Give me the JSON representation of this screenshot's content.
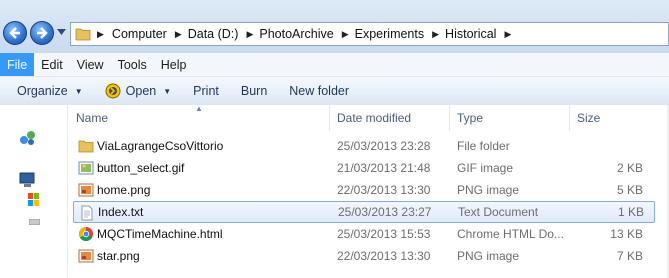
{
  "address_bar": {
    "crumbs": [
      "Computer",
      "Data (D:)",
      "PhotoArchive",
      "Experiments",
      "Historical"
    ]
  },
  "menu": [
    "File",
    "Edit",
    "View",
    "Tools",
    "Help"
  ],
  "command_bar": {
    "organize": "Organize",
    "open": "Open",
    "print": "Print",
    "burn": "Burn",
    "new_folder": "New folder"
  },
  "columns": {
    "name": "Name",
    "date_modified": "Date modified",
    "type": "Type",
    "size": "Size"
  },
  "files": [
    {
      "name": "ViaLagrangeCsoVittorio",
      "date": "25/03/2013 23:28",
      "type": "File folder",
      "size": "",
      "icon": "folder-icon"
    },
    {
      "name": "button_select.gif",
      "date": "21/03/2013 21:48",
      "type": "GIF image",
      "size": "2 KB",
      "icon": "image-file-icon"
    },
    {
      "name": "home.png",
      "date": "22/03/2013 13:30",
      "type": "PNG image",
      "size": "5 KB",
      "icon": "image-file-icon"
    },
    {
      "name": "Index.txt",
      "date": "25/03/2013 23:27",
      "type": "Text Document",
      "size": "1 KB",
      "icon": "text-file-icon"
    },
    {
      "name": "MQCTimeMachine.html",
      "date": "25/03/2013 15:53",
      "type": "Chrome HTML Do...",
      "size": "13 KB",
      "icon": "chrome-icon"
    },
    {
      "name": "star.png",
      "date": "22/03/2013 13:30",
      "type": "PNG image",
      "size": "7 KB",
      "icon": "image-file-icon"
    }
  ],
  "colors": {
    "menu_active": "#3399ff",
    "selection_border": "#84acdd",
    "folder": "#e8c15a"
  }
}
